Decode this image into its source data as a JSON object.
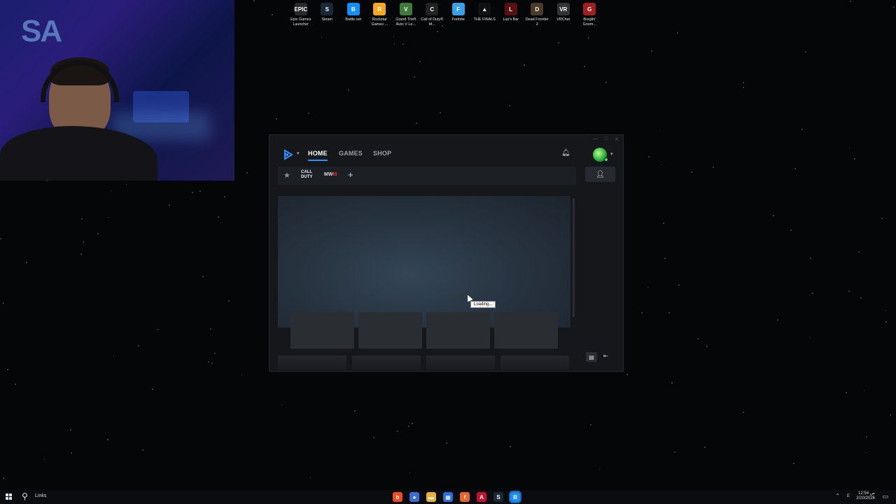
{
  "desktop": {
    "icons": [
      {
        "label": "Epic Games Launcher",
        "icon": "epic-games-icon",
        "glyph": "EPIC",
        "color": "#2b2b2b"
      },
      {
        "label": "Steam",
        "icon": "steam-icon",
        "glyph": "S",
        "color": "#1b2838"
      },
      {
        "label": "Battle.net",
        "icon": "battlenet-icon",
        "glyph": "B",
        "color": "#148eff"
      },
      {
        "label": "Rockstar Games ...",
        "icon": "rockstar-icon",
        "glyph": "R",
        "color": "#f5a623"
      },
      {
        "label": "Grand Theft Auto V Le...",
        "icon": "gta-icon",
        "glyph": "V",
        "color": "#3f7a3a"
      },
      {
        "label": "Call of Duty® M...",
        "icon": "cod-icon",
        "glyph": "C",
        "color": "#222"
      },
      {
        "label": "Fortnite",
        "icon": "fortnite-icon",
        "glyph": "F",
        "color": "#3aa0e8"
      },
      {
        "label": "THE FINALS",
        "icon": "the-finals-icon",
        "glyph": "▲",
        "color": "#111"
      },
      {
        "label": "Liar's Bar",
        "icon": "liars-bar-icon",
        "glyph": "L",
        "color": "#5a1010"
      },
      {
        "label": "Dead Frontier 2",
        "icon": "dead-frontier-icon",
        "glyph": "D",
        "color": "#4a3a2a"
      },
      {
        "label": "VRChat",
        "icon": "vrchat-icon",
        "glyph": "VR",
        "color": "#333"
      },
      {
        "label": "Burglin' Gnom...",
        "icon": "burglin-gnomes-icon",
        "glyph": "G",
        "color": "#a02020"
      }
    ]
  },
  "webcam": {
    "neon_sign": "SA"
  },
  "app": {
    "nav": {
      "tabs": [
        {
          "label": "HOME",
          "active": true
        },
        {
          "label": "GAMES",
          "active": false
        },
        {
          "label": "SHOP",
          "active": false
        }
      ]
    },
    "gamebar": {
      "cod_label": "CALL DUTY",
      "mw_label": "MW",
      "mw_accent": "III"
    },
    "accent_color": "#2e90ff",
    "tooltip": "Loading..."
  },
  "taskbar": {
    "search_label": "Links",
    "apps": [
      {
        "icon": "brave-icon",
        "glyph": "b",
        "color": "#f04a1d"
      },
      {
        "icon": "chrome-icon",
        "glyph": "●",
        "color": "#3a6cd1"
      },
      {
        "icon": "file-explorer-icon",
        "glyph": "▬",
        "color": "#e8b23a"
      },
      {
        "icon": "store-icon",
        "glyph": "▦",
        "color": "#2a6ed8"
      },
      {
        "icon": "firefox-icon",
        "glyph": "f",
        "color": "#e8642a"
      },
      {
        "icon": "adobe-icon",
        "glyph": "A",
        "color": "#c8102e"
      },
      {
        "icon": "steam-tb-icon",
        "glyph": "S",
        "color": "#1b2838"
      },
      {
        "icon": "battlenet-tb-icon",
        "glyph": "B",
        "color": "#148eff"
      }
    ],
    "tray_lang": "E",
    "clock_time": "12:54 ص",
    "clock_date": "2/20/2026"
  }
}
